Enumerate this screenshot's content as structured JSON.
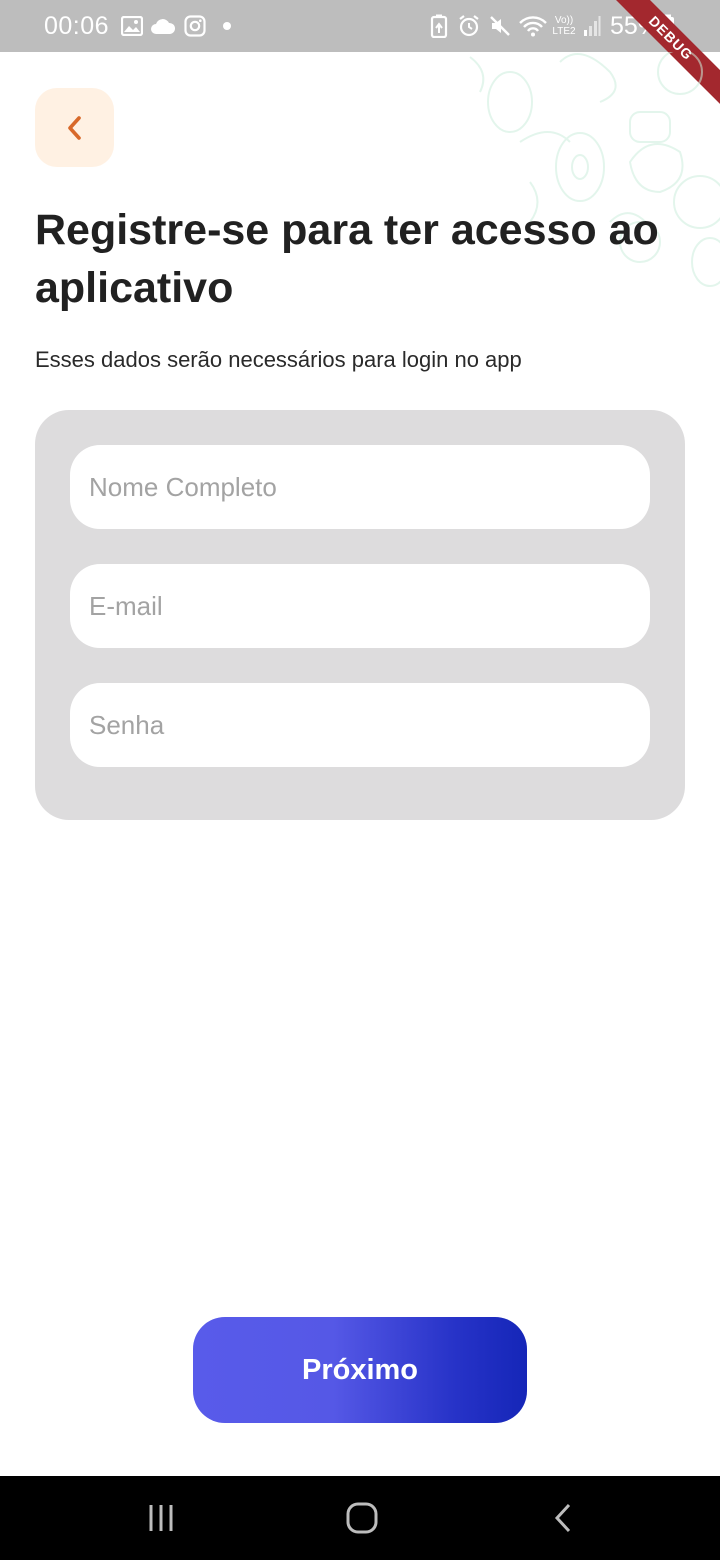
{
  "status_bar": {
    "time": "00:06",
    "battery": "55%",
    "icons": [
      "gallery-icon",
      "cloud-icon",
      "instagram-icon",
      "dot-icon",
      "battery-saver-icon",
      "alarm-icon",
      "mute-icon",
      "wifi-icon",
      "volte-icon",
      "signal-icon",
      "battery-icon"
    ],
    "volte_label": "Vo))",
    "lte_label": "LTE2"
  },
  "debug_banner": "DEBUG",
  "header": {
    "back_icon": "chevron-left-icon",
    "title": "Registre-se para ter acesso ao aplicativo",
    "subtitle": "Esses dados serão necessários para login no app"
  },
  "form": {
    "name_placeholder": "Nome Completo",
    "name_value": "",
    "email_placeholder": "E-mail",
    "email_value": "",
    "password_placeholder": "Senha",
    "password_value": ""
  },
  "actions": {
    "next_label": "Próximo"
  },
  "nav_bar": {
    "icons": [
      "recent-apps-icon",
      "home-icon",
      "back-icon"
    ]
  },
  "colors": {
    "accent_orange": "#d8692a",
    "back_button_bg": "#fff1e3",
    "card_bg": "#dddcdd",
    "button_gradient_start": "#585bea",
    "button_gradient_end": "#1526b8"
  }
}
